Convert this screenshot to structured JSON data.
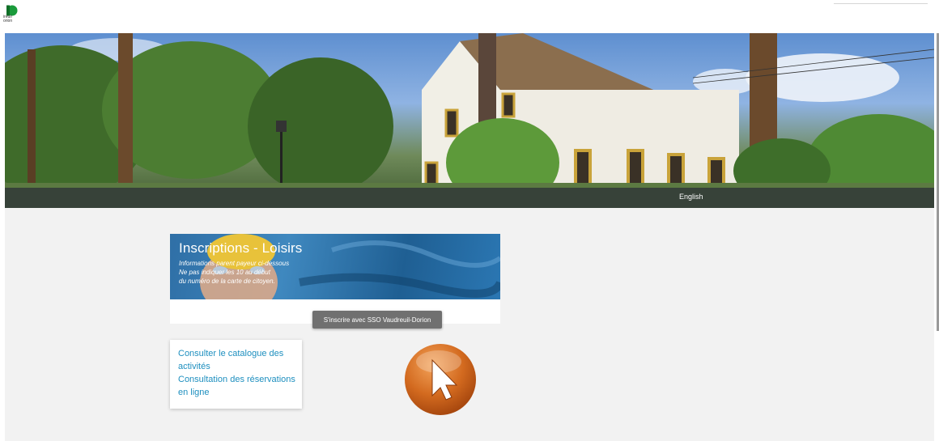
{
  "logo": {
    "text_line1": "ireuil",
    "text_line2": "orion",
    "color": "#1a9b3b"
  },
  "hero": {
    "language_link": "English"
  },
  "banner": {
    "title": "Inscriptions - Loisirs",
    "line1": "Informations parent payeur ci-dessous",
    "line2": "Ne pas indiquer les 10 au début",
    "line3": "du numéro de la carte de citoyen.",
    "sso_button_label": "S'inscrire avec SSO Vaudreuil-Dorion"
  },
  "links": {
    "catalogue": "Consulter le catalogue des activités",
    "reservations": "Consultation des réservations en ligne"
  },
  "colors": {
    "link": "#1e8fbf",
    "content_bg": "#f2f2f2",
    "button_bg": "#707070",
    "cursor_orange": "#d36a1f"
  },
  "icons": {
    "cursor": "pointer-cursor-icon"
  }
}
